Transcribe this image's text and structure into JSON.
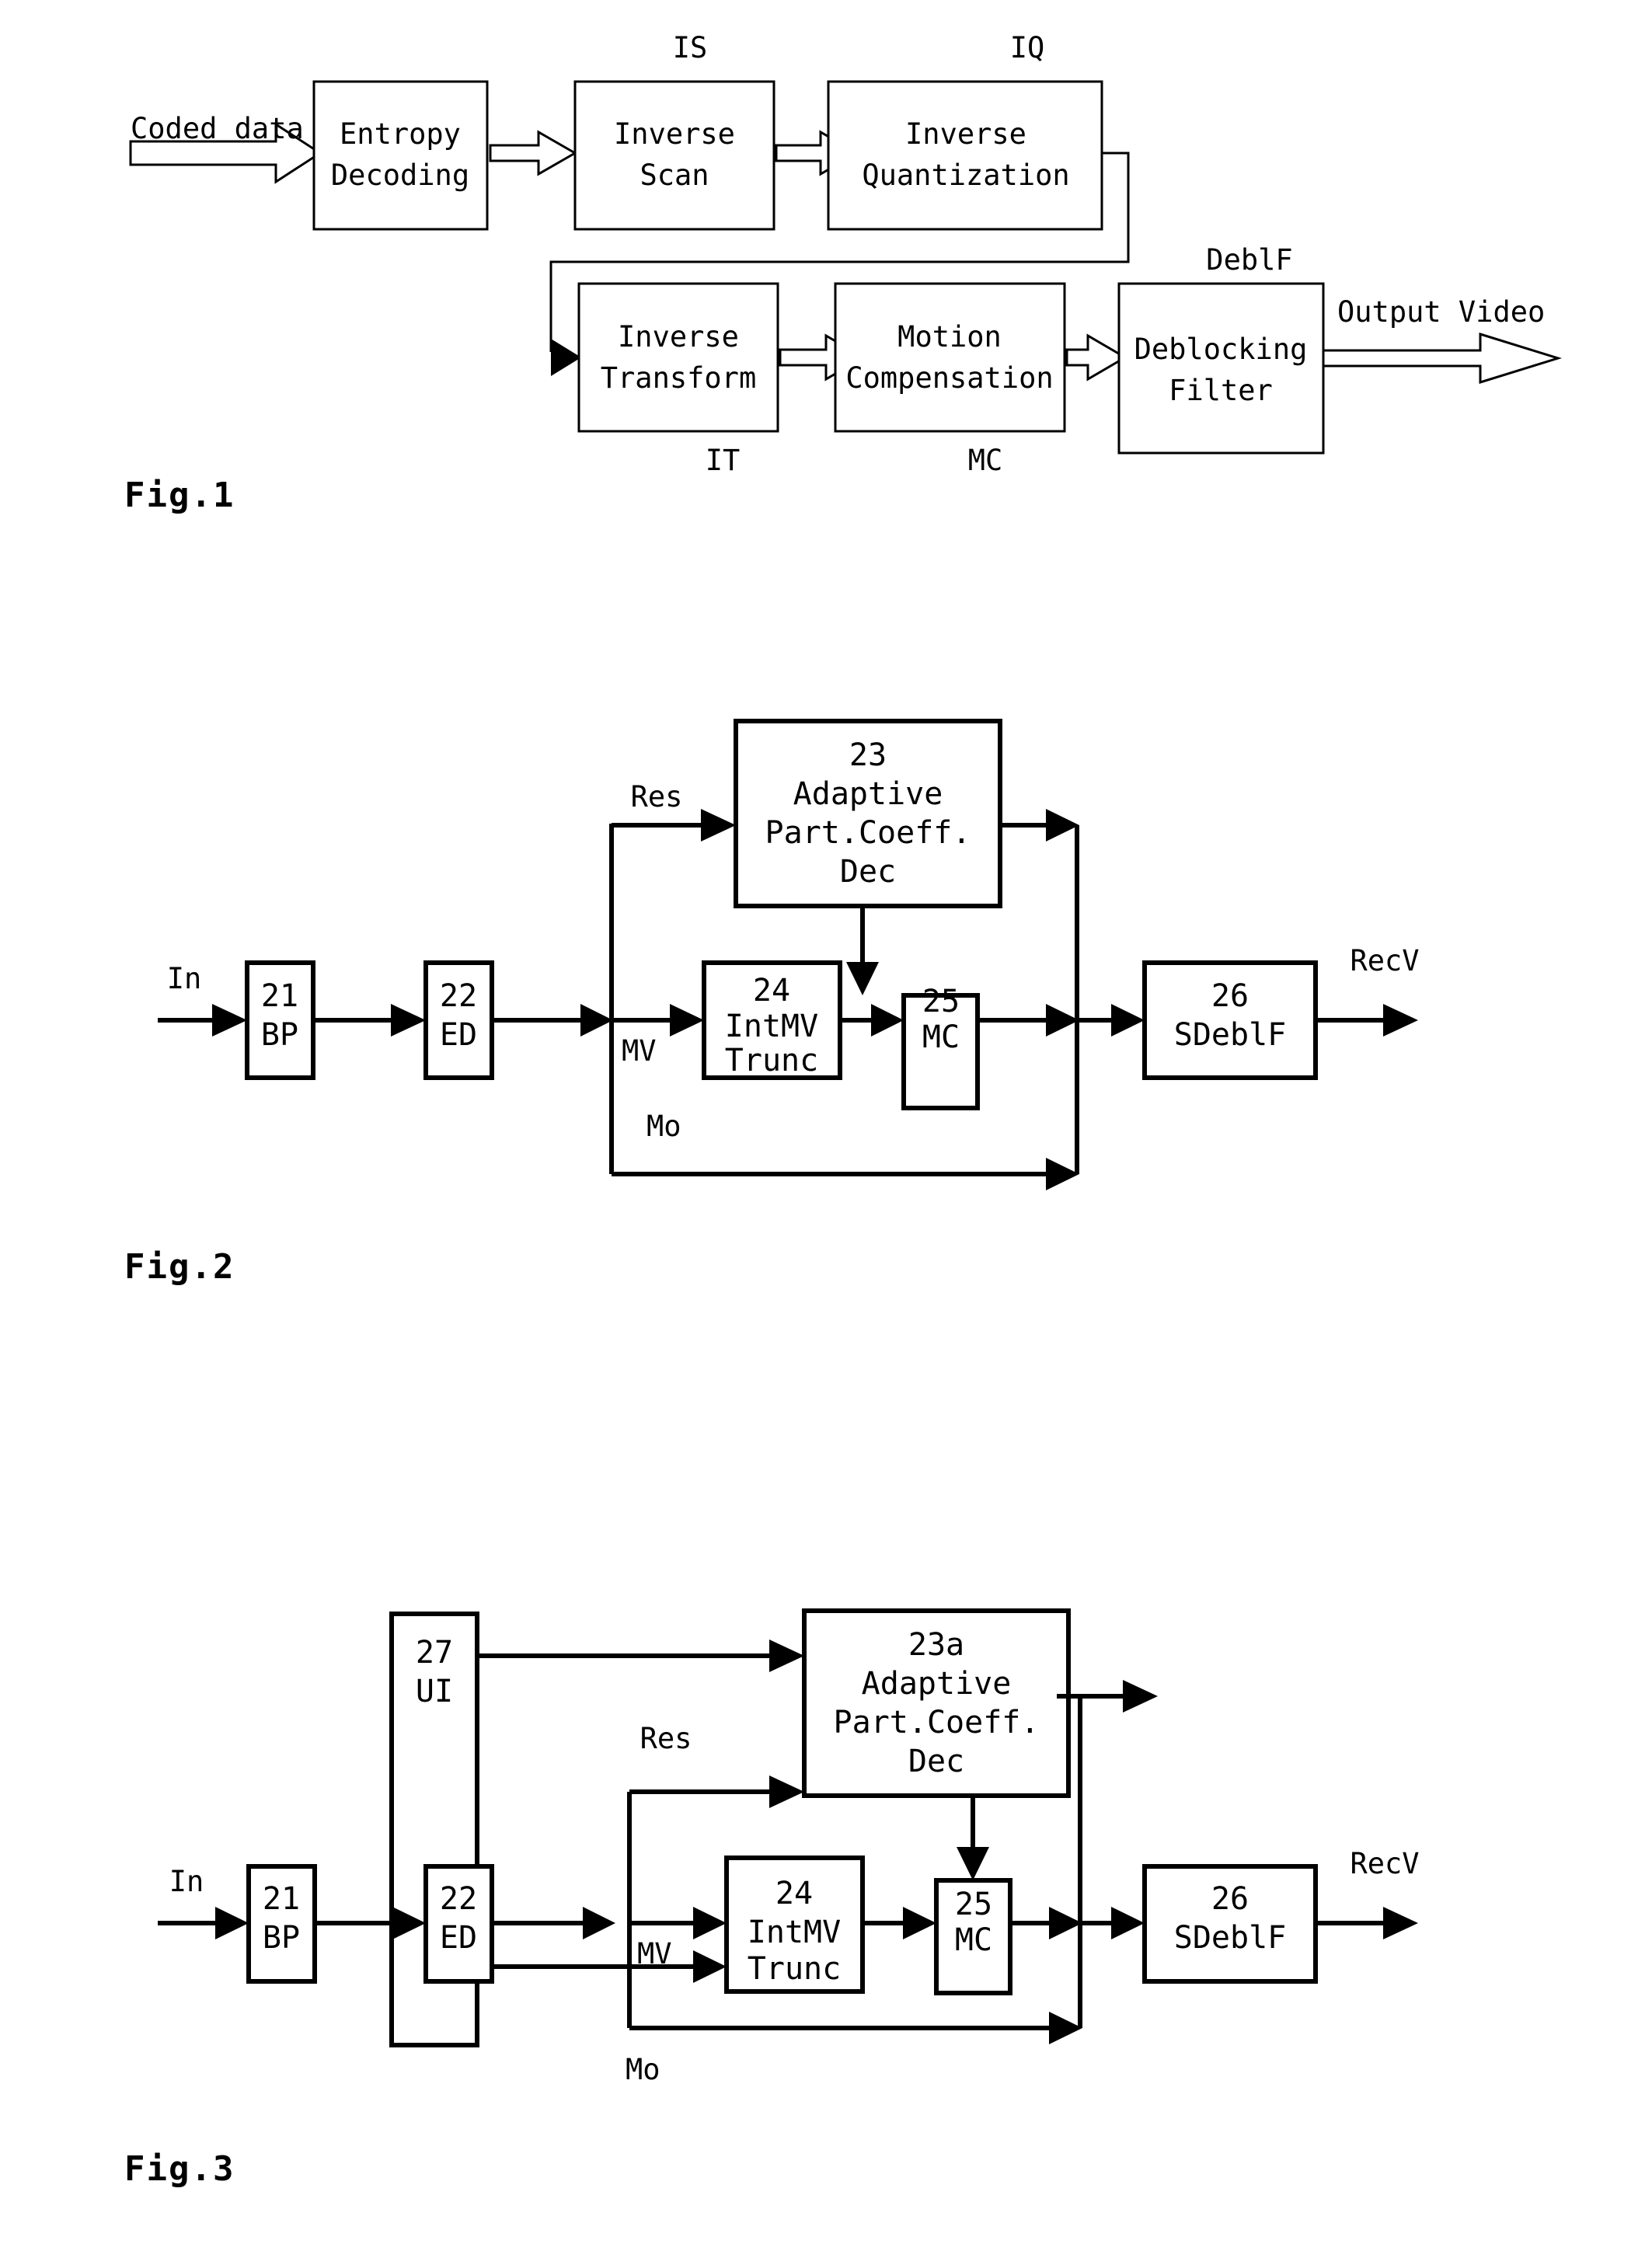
{
  "document": {
    "kind": "patent-figure-sheet",
    "figures": [
      "Fig.1",
      "Fig.2",
      "Fig.3"
    ]
  },
  "fig1": {
    "caption": "Fig.1",
    "input_label": "Coded data",
    "output_label": "Output Video",
    "boxes": [
      {
        "id": "entropy-decoding",
        "line1": "Entropy",
        "line2": "Decoding",
        "tag": ""
      },
      {
        "id": "inverse-scan",
        "line1": "Inverse",
        "line2": "Scan",
        "tag": "IS"
      },
      {
        "id": "inverse-quantization",
        "line1": "Inverse",
        "line2": "Quantization",
        "tag": "IQ"
      },
      {
        "id": "inverse-transform",
        "line1": "Inverse",
        "line2": "Transform",
        "tag": "IT"
      },
      {
        "id": "motion-compensation",
        "line1": "Motion",
        "line2": "Compensation",
        "tag": "MC"
      },
      {
        "id": "deblocking-filter",
        "line1": "Deblocking",
        "line2": "Filter",
        "tag": "DeblF"
      }
    ],
    "tags": {
      "is": "IS",
      "iq": "IQ",
      "it": "IT",
      "mc": "MC",
      "deblf": "DeblF"
    }
  },
  "fig2": {
    "caption": "Fig.2",
    "input_label": "In",
    "output_label": "RecV",
    "signal_labels": {
      "res": "Res",
      "mv": "MV",
      "mo": "Mo"
    },
    "boxes": [
      {
        "id": "bp",
        "num": "21",
        "name": "BP"
      },
      {
        "id": "ed",
        "num": "22",
        "name": "ED"
      },
      {
        "id": "apcd",
        "num": "23",
        "name": "Adaptive Part.Coeff. Dec",
        "l1": "Adaptive",
        "l2": "Part.Coeff.",
        "l3": "Dec"
      },
      {
        "id": "intmvtrunc",
        "num": "24",
        "l1": "IntMV",
        "l2": "Trunc"
      },
      {
        "id": "mc",
        "num": "25",
        "name": "MC"
      },
      {
        "id": "sdeblf",
        "num": "26",
        "name": "SDeblF"
      }
    ]
  },
  "fig3": {
    "caption": "Fig.3",
    "input_label": "In",
    "output_label": "RecV",
    "signal_labels": {
      "res": "Res",
      "mv": "MV",
      "mo": "Mo"
    },
    "boxes": [
      {
        "id": "ui",
        "num": "27",
        "name": "UI"
      },
      {
        "id": "bp",
        "num": "21",
        "name": "BP"
      },
      {
        "id": "ed",
        "num": "22",
        "name": "ED"
      },
      {
        "id": "apcd",
        "num": "23a",
        "l1": "Adaptive",
        "l2": "Part.Coeff.",
        "l3": "Dec"
      },
      {
        "id": "intmvtrunc",
        "num": "24",
        "l1": "IntMV",
        "l2": "Trunc"
      },
      {
        "id": "mc",
        "num": "25",
        "name": "MC"
      },
      {
        "id": "sdeblf",
        "num": "26",
        "name": "SDeblF"
      }
    ]
  },
  "colors": {
    "ink": "#000000",
    "paper": "#ffffff"
  }
}
